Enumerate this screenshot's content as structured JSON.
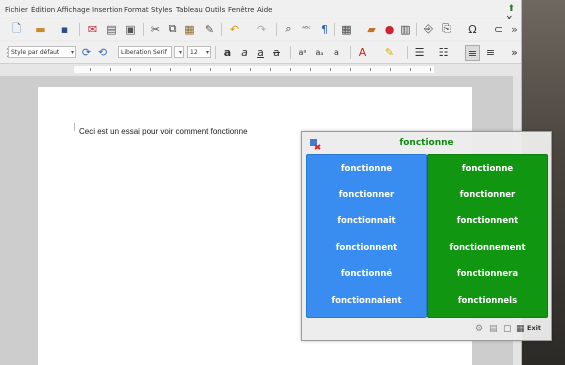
{
  "menubar": {
    "items": [
      "Fichier",
      "Édition",
      "Affichage",
      "Insertion",
      "Format",
      "Styles",
      "Tableau",
      "Outils",
      "Fenêtre",
      "Aide"
    ]
  },
  "toolbar": {
    "paragraph_style": "Style par défaut",
    "font_name": "Liberation Serif",
    "font_size": "12"
  },
  "document": {
    "text": "Ceci est un essai pour voir comment fonctionne"
  },
  "prediction_popup": {
    "title": "fonctionne",
    "left_words": [
      "fonctionne",
      "fonctionner",
      "fonctionnait",
      "fonctionnent",
      "fonctionné",
      "fonctionnaient"
    ],
    "right_words": [
      "fonctionne",
      "fonctionner",
      "fonctionnent",
      "fonctionnement",
      "fonctionnera",
      "fonctionnels"
    ],
    "bottom_label": "Exit",
    "colors": {
      "title": "#118a11",
      "left": "#3a8df0",
      "right": "#119611"
    }
  }
}
